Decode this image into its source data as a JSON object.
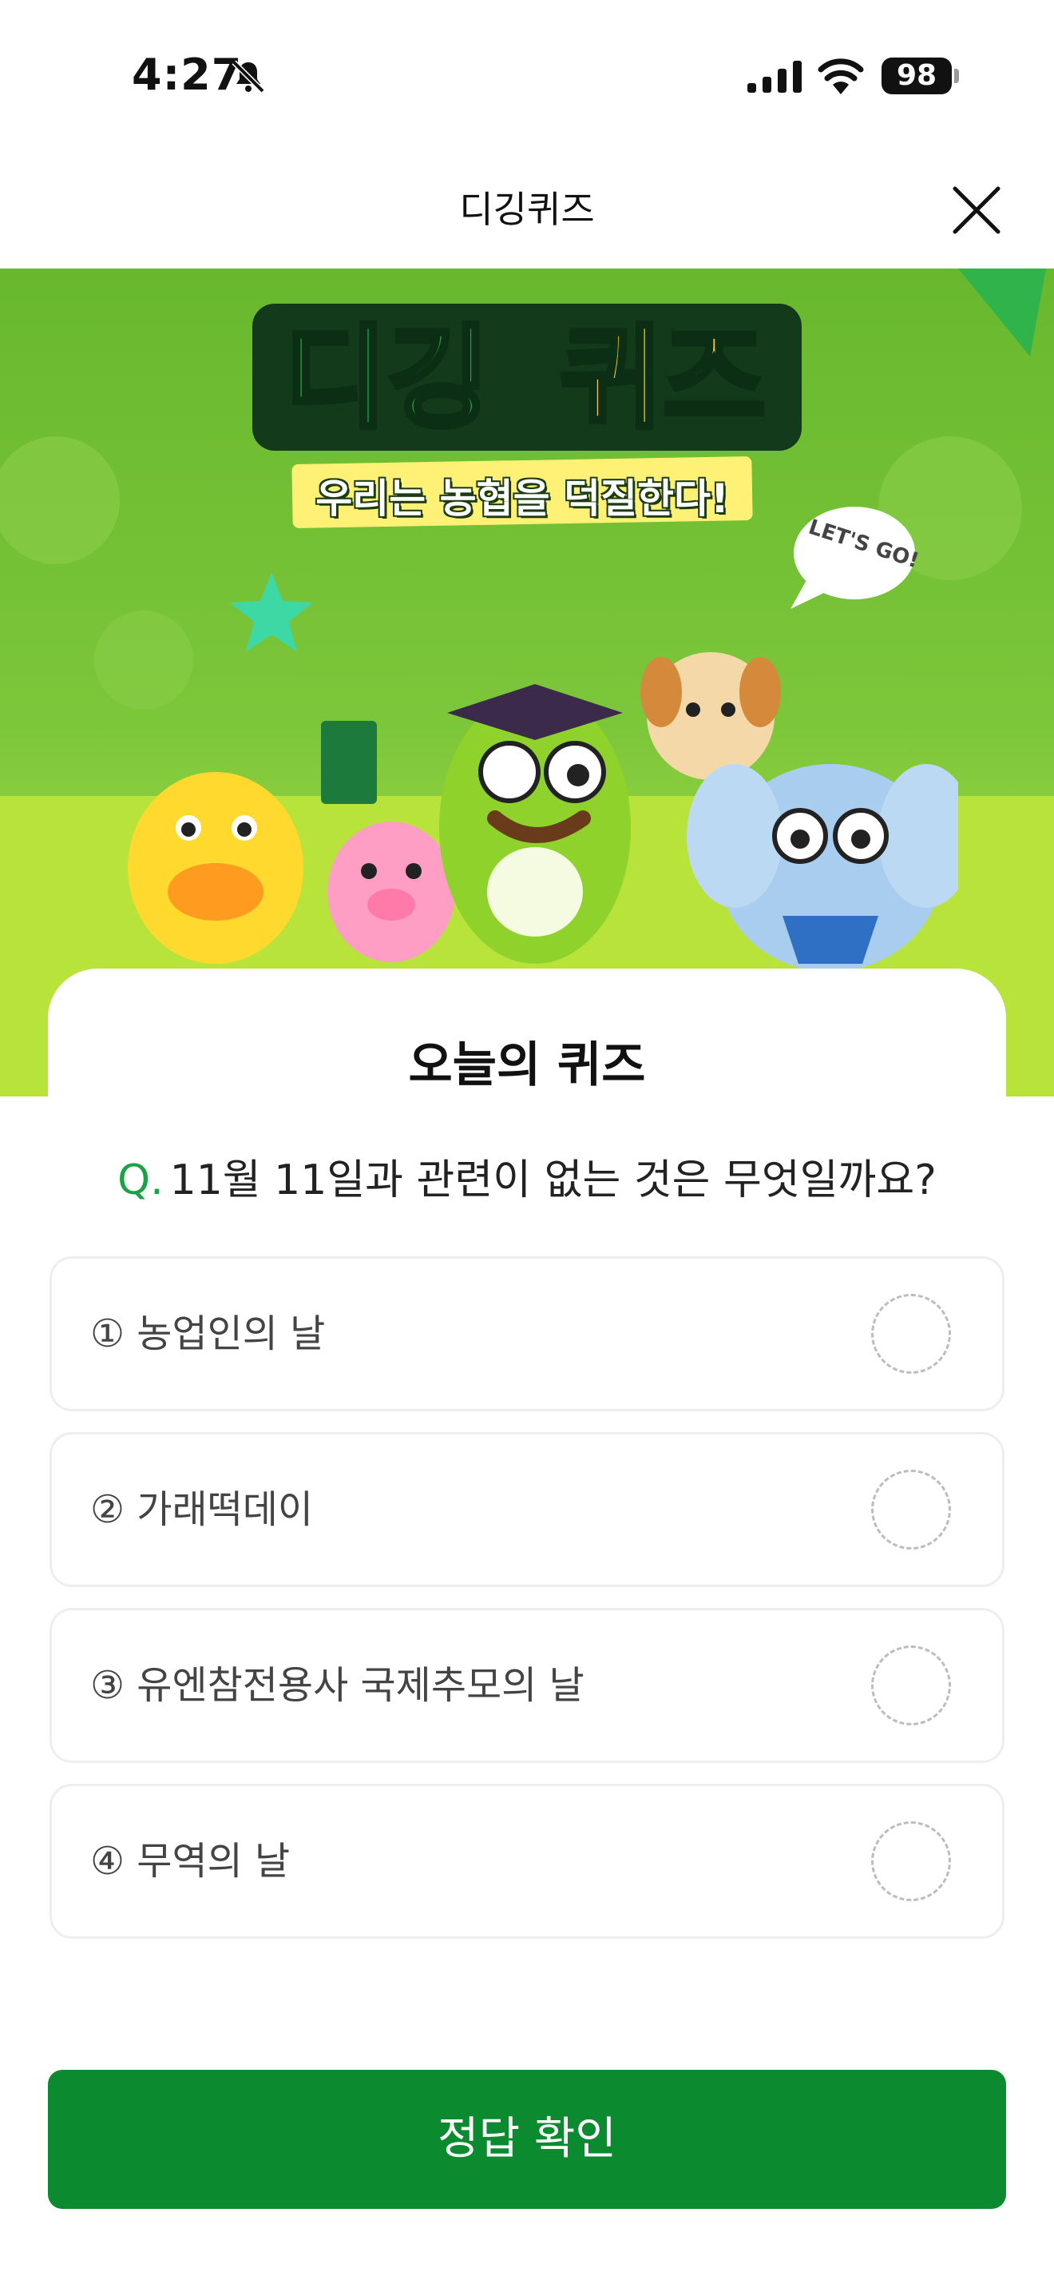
{
  "status_bar": {
    "time": "4:27",
    "battery": "98"
  },
  "nav": {
    "title": "디깅퀴즈"
  },
  "hero": {
    "title_left": "디깅",
    "title_right": "퀴즈",
    "subtitle": "우리는 농협을 덕질한다!",
    "bubble_text": "LET'S GO!"
  },
  "quiz": {
    "badge": "오늘의 퀴즈",
    "question_prefix": "Q.",
    "question": "11월 11일과 관련이 없는 것은 무엇일까요?",
    "options": [
      {
        "label": "① 농업인의 날"
      },
      {
        "label": "② 가래떡데이"
      },
      {
        "label": "③ 유엔참전용사 국제추모의 날"
      },
      {
        "label": "④ 무역의 날"
      }
    ],
    "submit_label": "정답 확인"
  },
  "colors": {
    "primary": "#0b8a30",
    "accent": "#1aa247",
    "hero_green": "#7cc63a"
  }
}
